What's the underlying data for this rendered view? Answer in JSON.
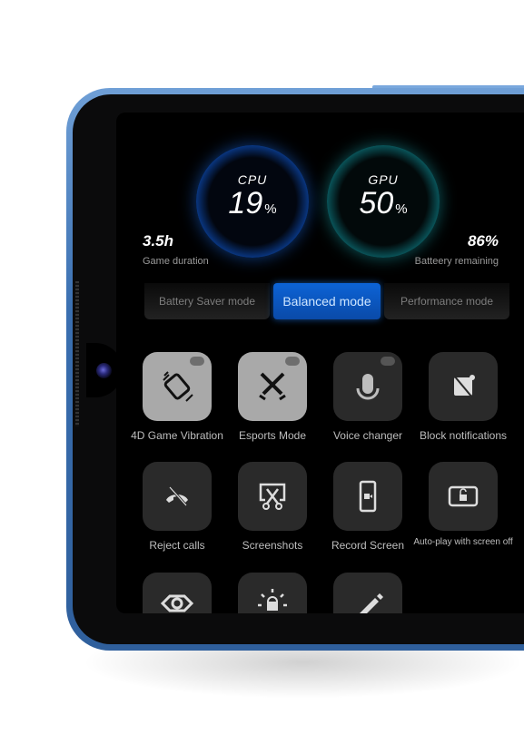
{
  "gauges": {
    "cpu": {
      "label": "CPU",
      "value": "19",
      "unit": "%"
    },
    "gpu": {
      "label": "GPU",
      "value": "50",
      "unit": "%"
    }
  },
  "stats": {
    "game_duration": {
      "value": "3.5h",
      "label": "Game  duration"
    },
    "battery": {
      "value": "86%",
      "label": "Batteery  remaining"
    }
  },
  "modes": [
    {
      "label": "Battery Saver mode",
      "active": false
    },
    {
      "label": "Balanced mode",
      "active": true
    },
    {
      "label": "Performance mode",
      "active": false
    }
  ],
  "tiles": [
    {
      "label": "4D Game Vibration",
      "icon": "vibration-icon",
      "on": true,
      "game_badge": true
    },
    {
      "label": "Esports Mode",
      "icon": "crossed-swords-icon",
      "on": true,
      "game_badge": true
    },
    {
      "label": "Voice changer",
      "icon": "microphone-icon",
      "on": false,
      "game_badge": true
    },
    {
      "label": "Block notifications",
      "icon": "block-notification-icon",
      "on": false
    },
    {
      "label": "Reject calls",
      "icon": "reject-call-icon",
      "on": false
    },
    {
      "label": "Screenshots",
      "icon": "screenshot-scissors-icon",
      "on": false
    },
    {
      "label": "Record Screen",
      "icon": "record-screen-icon",
      "on": false
    },
    {
      "label": "Auto-play with screen off",
      "icon": "screen-lock-icon",
      "on": false
    },
    {
      "icon": "eye-icon"
    },
    {
      "icon": "brightness-lock-icon"
    },
    {
      "icon": "pencil-icon"
    }
  ],
  "colors": {
    "accent_blue": "#0c63d6",
    "gpu_teal": "#1fc7c7",
    "frame_blue": "#3a6fb0"
  }
}
